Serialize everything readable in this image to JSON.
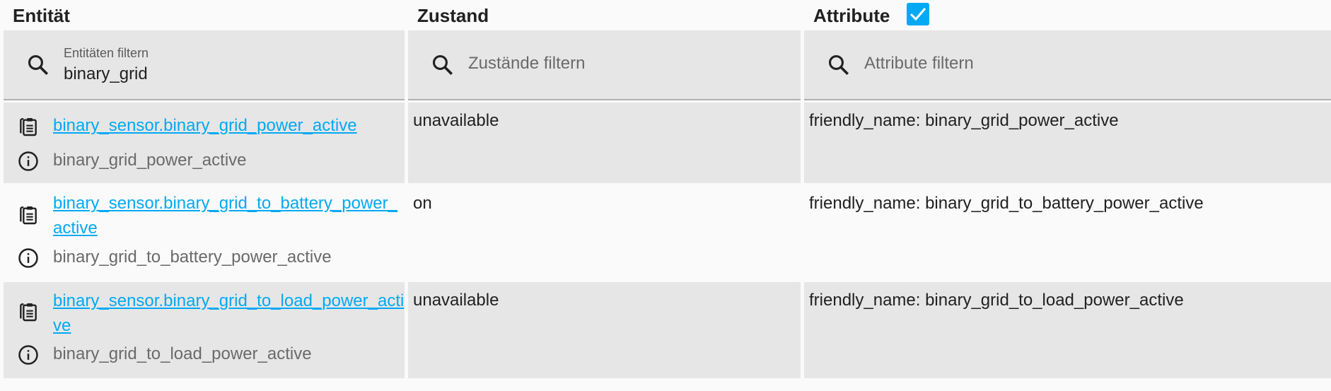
{
  "header": {
    "entity_label": "Entität",
    "state_label": "Zustand",
    "attributes_label": "Attribute",
    "attributes_checked": true
  },
  "filters": {
    "entity": {
      "label": "Entitäten filtern",
      "value": "binary_grid"
    },
    "state": {
      "placeholder": "Zustände filtern",
      "value": ""
    },
    "attributes": {
      "placeholder": "Attribute filtern",
      "value": ""
    }
  },
  "rows": [
    {
      "entity_id": "binary_sensor.binary_grid_power_active",
      "friendly_name": "binary_grid_power_active",
      "state": "unavailable",
      "attributes": "friendly_name: binary_grid_power_active"
    },
    {
      "entity_id": "binary_sensor.binary_grid_to_battery_power_active",
      "friendly_name": "binary_grid_to_battery_power_active",
      "state": "on",
      "attributes": "friendly_name: binary_grid_to_battery_power_active"
    },
    {
      "entity_id": "binary_sensor.binary_grid_to_load_power_active",
      "friendly_name": "binary_grid_to_load_power_active",
      "state": "unavailable",
      "attributes": "friendly_name: binary_grid_to_load_power_active"
    }
  ],
  "colors": {
    "accent": "#03a9f4",
    "row_grey": "#e6e6e6",
    "background": "#fafafa",
    "secondary_text": "#6a6a6a"
  },
  "icons": {
    "search": "search-icon",
    "copy": "clipboard-icon",
    "info": "info-icon",
    "check": "checkmark-icon"
  }
}
